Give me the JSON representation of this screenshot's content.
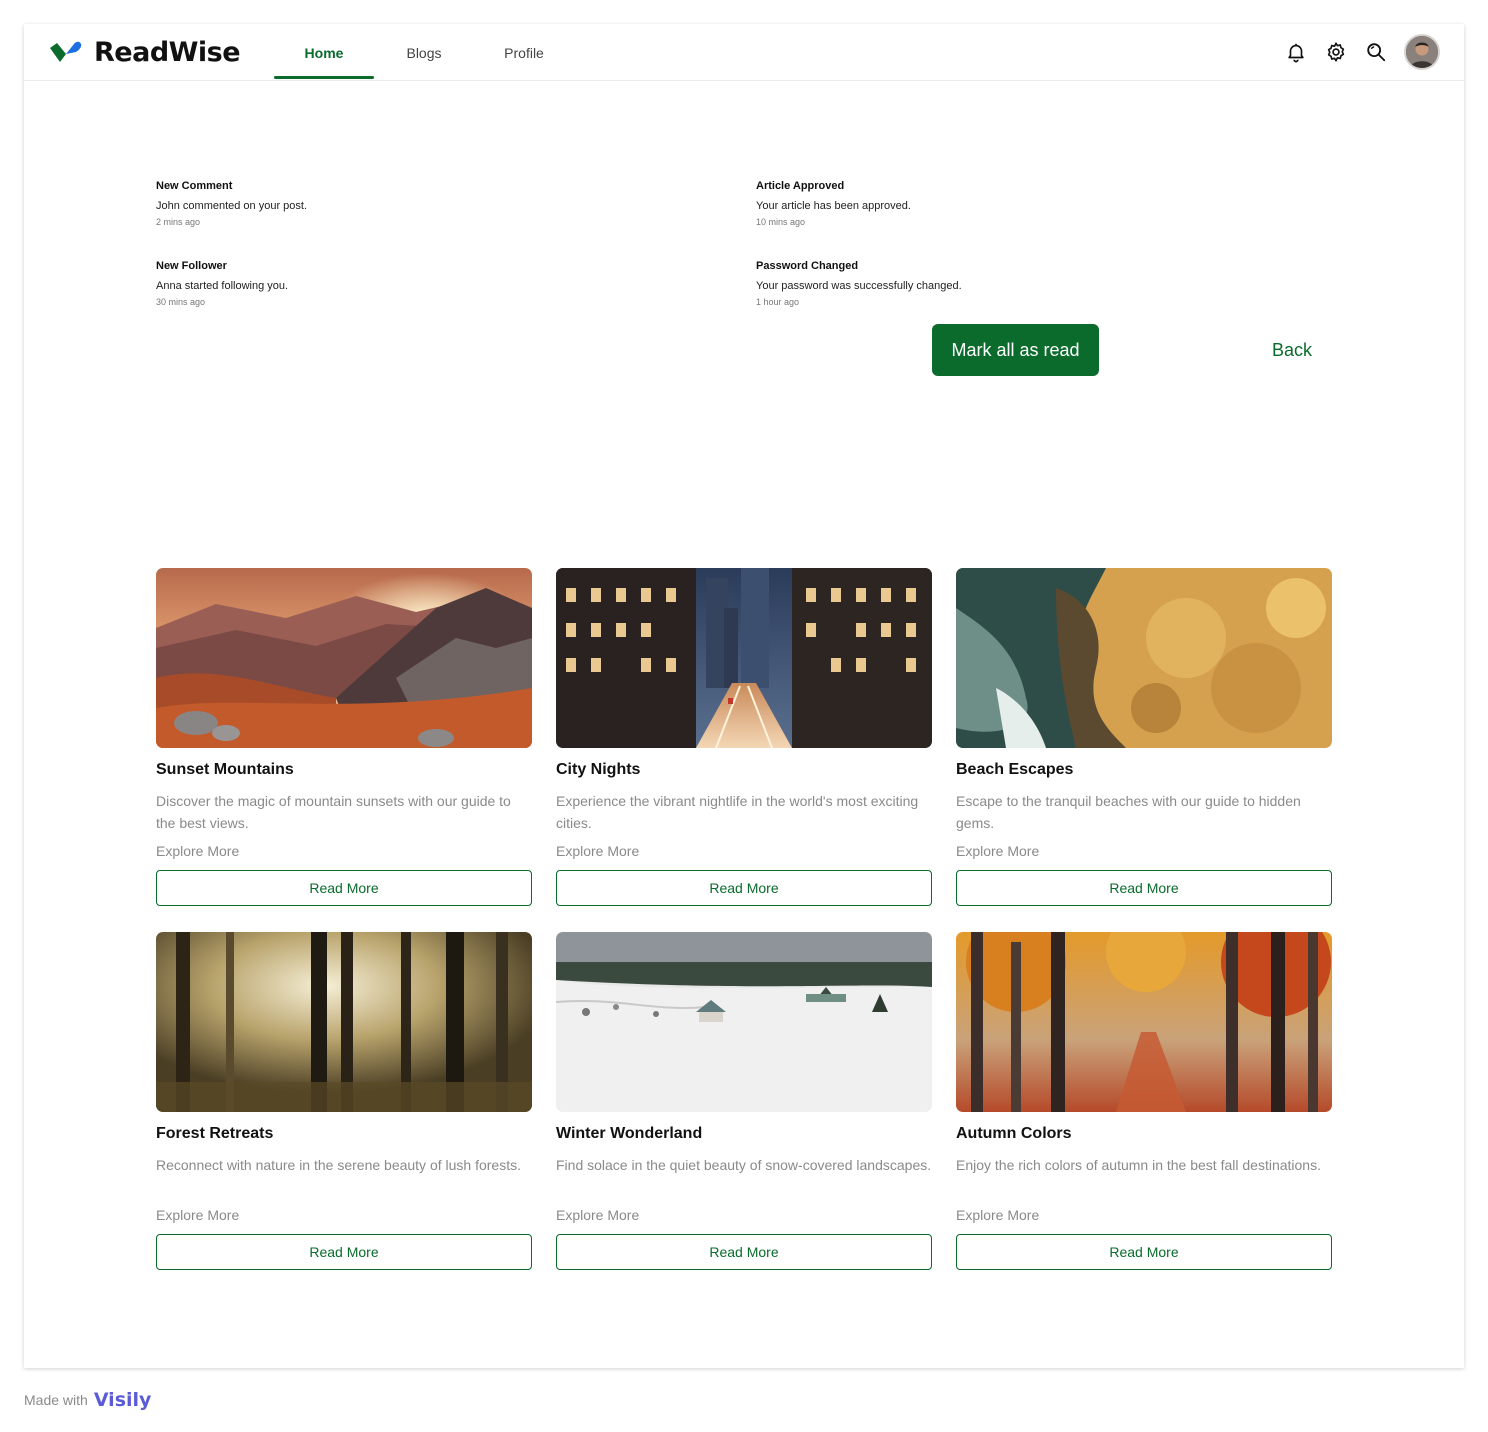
{
  "app": {
    "name": "ReadWise",
    "brand_color": "#0a6b2c",
    "logo_colors": [
      "#0a6b2c",
      "#1d6fe0"
    ]
  },
  "nav": {
    "tabs": [
      {
        "label": "Home",
        "active": true
      },
      {
        "label": "Blogs",
        "active": false
      },
      {
        "label": "Profile",
        "active": false
      }
    ]
  },
  "header_icons": [
    "bell-icon",
    "gear-icon",
    "search-icon",
    "avatar"
  ],
  "notifications": [
    {
      "title": "New Comment",
      "message": "John commented on your post.",
      "time": "2 mins ago"
    },
    {
      "title": "Article Approved",
      "message": "Your article has been approved.",
      "time": "10 mins ago"
    },
    {
      "title": "New Follower",
      "message": "Anna started following you.",
      "time": "30 mins ago"
    },
    {
      "title": "Password Changed",
      "message": "Your password was successfully changed.",
      "time": "1 hour ago"
    }
  ],
  "actions": {
    "mark_all_read": "Mark all as read",
    "back": "Back"
  },
  "cards": [
    {
      "title": "Sunset Mountains",
      "description": "Discover the magic of mountain sunsets with our guide to the best views.",
      "explore": "Explore More",
      "button": "Read More"
    },
    {
      "title": "City Nights",
      "description": "Experience the vibrant nightlife in the world's most exciting cities.",
      "explore": "Explore More",
      "button": "Read More"
    },
    {
      "title": "Beach Escapes",
      "description": "Escape to the tranquil beaches with our guide to hidden gems.",
      "explore": "Explore More",
      "button": "Read More"
    },
    {
      "title": "Forest Retreats",
      "description": "Reconnect with nature in the serene beauty of lush forests.",
      "explore": "Explore More",
      "button": "Read More"
    },
    {
      "title": "Winter Wonderland",
      "description": "Find solace in the quiet beauty of snow-covered landscapes.",
      "explore": "Explore More",
      "button": "Read More"
    },
    {
      "title": "Autumn Colors",
      "description": "Enjoy the rich colors of autumn in the best fall destinations.",
      "explore": "Explore More",
      "button": "Read More"
    }
  ],
  "footer": {
    "made_with": "Made with",
    "brand": "Visily"
  }
}
